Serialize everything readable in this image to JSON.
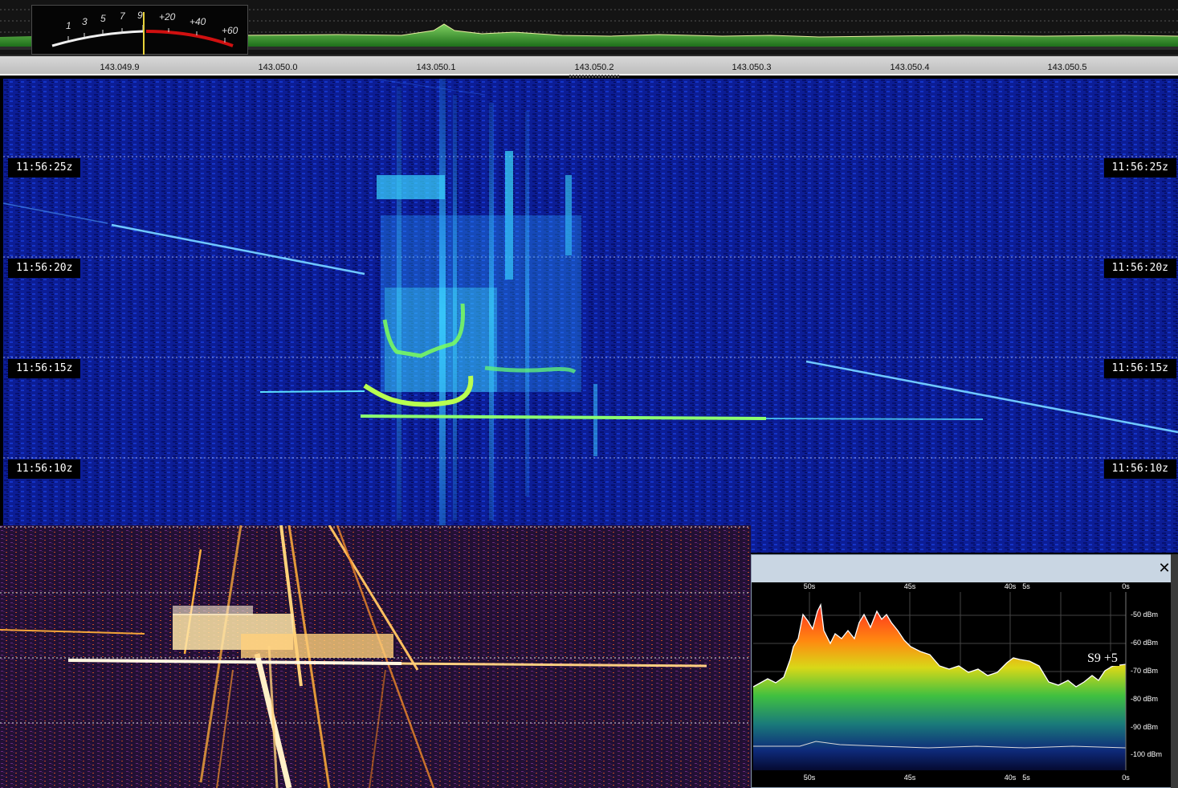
{
  "colors": {
    "spectrum_fill": "#2f9e2a",
    "waterfall_background": "#0a1a8c",
    "waterfall_signal": "#28e0ff",
    "waterfall_peak": "#60ff60",
    "orange_signal": "#ffd27a",
    "history_titlebar": "#c9d6e3"
  },
  "icons": {
    "close": "close-icon"
  },
  "smeter": {
    "scale_low": [
      "1",
      "3",
      "5",
      "7",
      "9"
    ],
    "scale_high": [
      "+20",
      "+40",
      "+60"
    ]
  },
  "frequency_scale": {
    "labels": [
      "143.049.9",
      "143.050.0",
      "143.050.1",
      "143.050.2",
      "143.050.3",
      "143.050.4",
      "143.050.5"
    ]
  },
  "waterfall": {
    "time_labels": [
      "11:56:25z",
      "11:56:20z",
      "11:56:15z",
      "11:56:10z"
    ]
  },
  "history_window": {
    "close_symbol": "✕",
    "x_labels_top": [
      "50s",
      "45s",
      "40s",
      "5s",
      "0s"
    ],
    "x_labels_bottom": [
      "50s",
      "45s",
      "40s",
      "5s",
      "0s"
    ],
    "y_labels": [
      "-50 dBm",
      "-60 dBm",
      "-70 dBm",
      "-80 dBm",
      "-90 dBm",
      "-100 dBm"
    ],
    "readout": "S9 +5"
  }
}
